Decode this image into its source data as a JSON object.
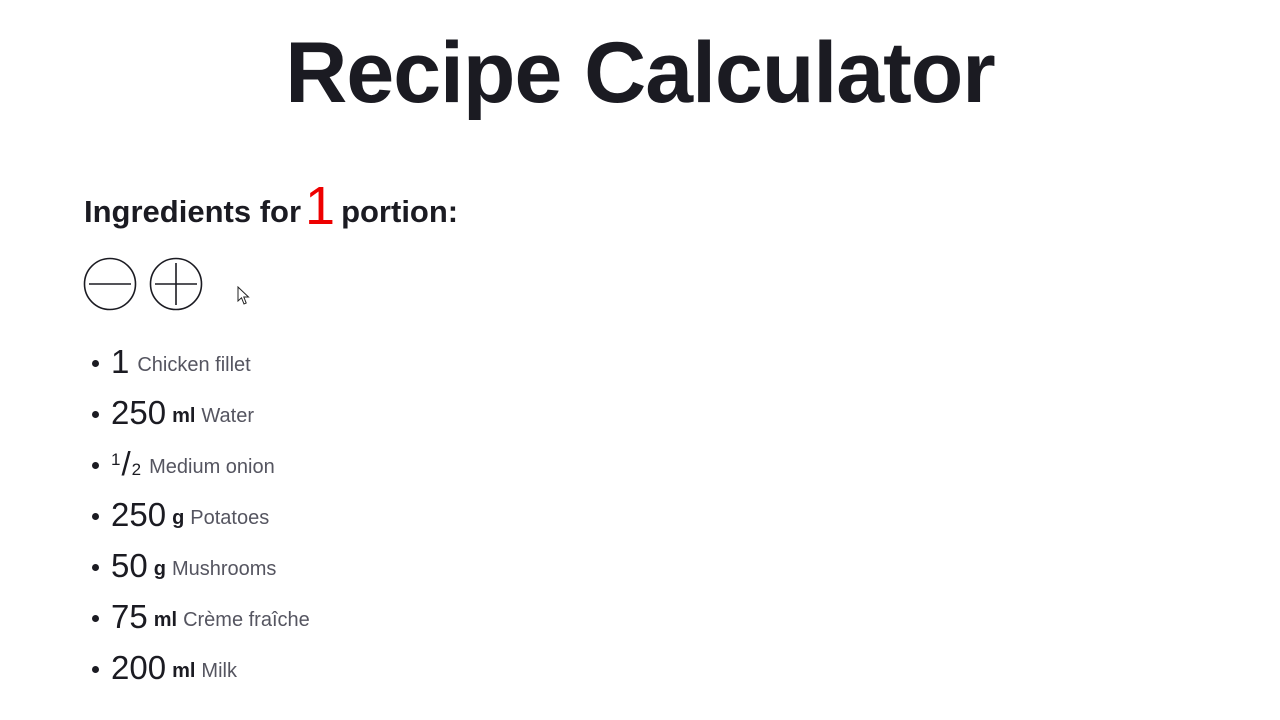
{
  "page": {
    "title": "Recipe Calculator"
  },
  "portions": {
    "prefix": "Ingredients for",
    "count": "1",
    "suffix": "portion:",
    "count_color": "#ee0000"
  },
  "controls": {
    "decrease_icon": "minus-circle-icon",
    "increase_icon": "plus-circle-icon"
  },
  "ingredients": [
    {
      "qty": "1",
      "unit": "",
      "name": "Chicken fillet"
    },
    {
      "qty": "250",
      "unit": "ml",
      "name": "Water"
    },
    {
      "qty_numerator": "1",
      "qty_denominator": "2",
      "unit": "",
      "name": "Medium onion"
    },
    {
      "qty": "250",
      "unit": "g",
      "name": "Potatoes"
    },
    {
      "qty": "50",
      "unit": "g",
      "name": "Mushrooms"
    },
    {
      "qty": "75",
      "unit": "ml",
      "name": "Crème fraîche"
    },
    {
      "qty": "200",
      "unit": "ml",
      "name": "Milk"
    }
  ]
}
